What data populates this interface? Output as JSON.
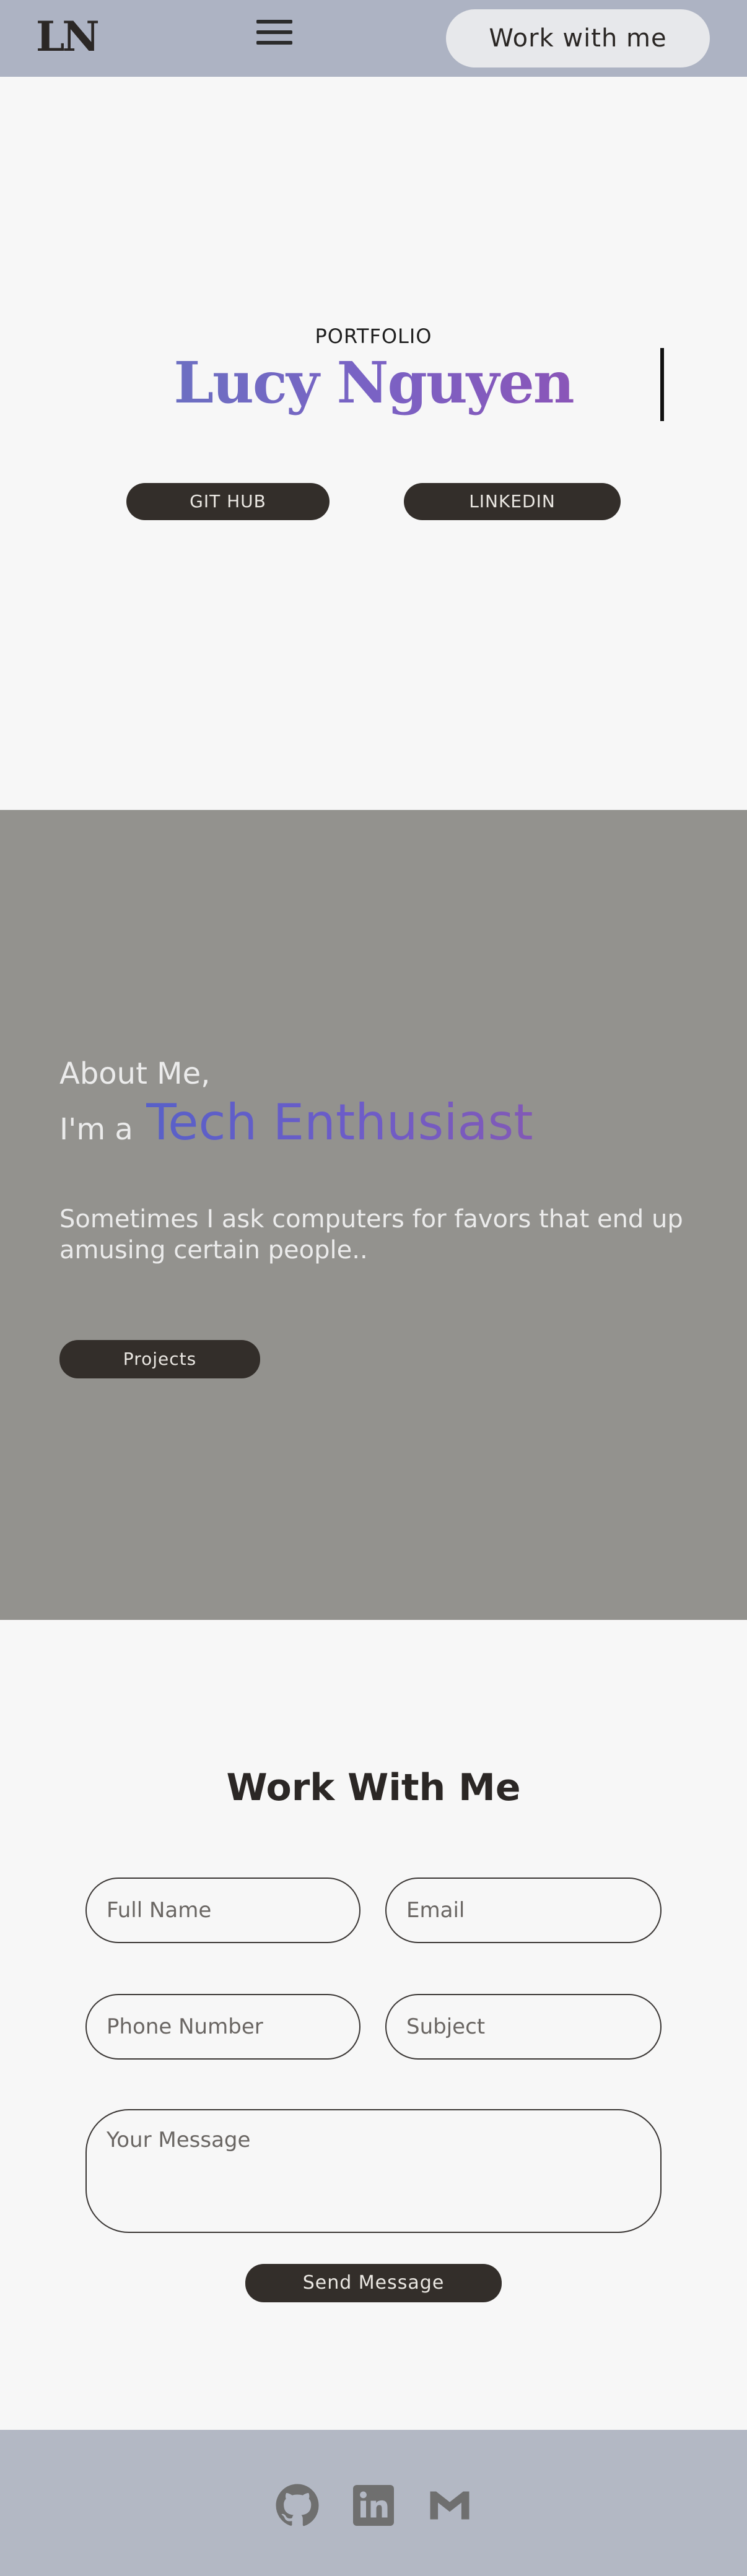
{
  "header": {
    "logo": "LN",
    "menu_icon": "hamburger-menu-icon",
    "cta_label": "Work with me"
  },
  "hero": {
    "eyebrow": "PORTFOLIO",
    "name": "Lucy Nguyen",
    "github_label": "GIT HUB",
    "linkedin_label": "LINKEDIN"
  },
  "about": {
    "title": "About Me,",
    "prefix": "I'm a",
    "role": "Tech Enthusiast",
    "description": "Sometimes I ask computers for favors that end up amusing certain people..",
    "projects_label": "Projects"
  },
  "contact": {
    "title": "Work With Me",
    "placeholders": {
      "full_name": "Full Name",
      "email": "Email",
      "phone": "Phone Number",
      "subject": "Subject",
      "message": "Your Message"
    },
    "send_label": "Send Message"
  },
  "footer": {
    "icons": [
      "github-icon",
      "linkedin-icon",
      "gmail-icon"
    ]
  },
  "colors": {
    "header_bg": "#adb3c3",
    "about_bg": "#93928e",
    "footer_bg": "#b3b8c4",
    "button_bg": "#332e2a",
    "accent_gradient": [
      "#6c6fc2",
      "#8a55b8"
    ]
  }
}
